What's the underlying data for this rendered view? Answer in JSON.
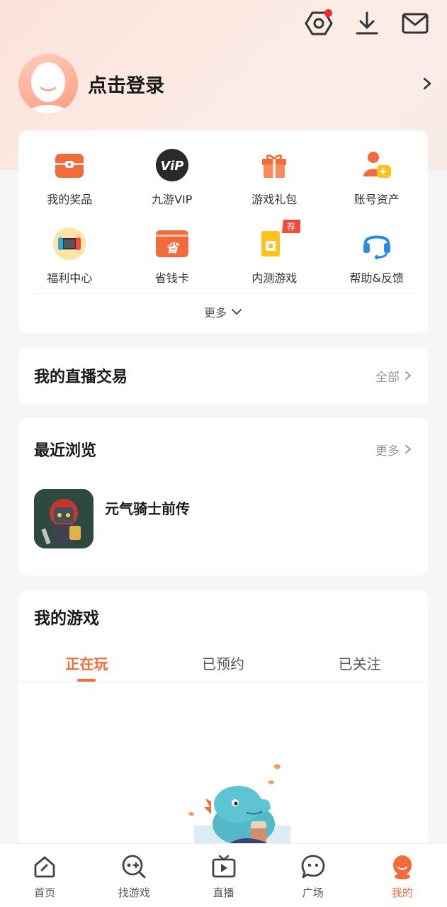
{
  "header": {
    "login_text": "点击登录",
    "icons": [
      "settings-hex-icon",
      "download-icon",
      "mail-icon"
    ],
    "settings_has_notification": true
  },
  "menu": {
    "items": [
      {
        "label": "我的奖品",
        "icon": "prize-box-icon"
      },
      {
        "label": "九游VIP",
        "icon": "vip-badge-icon"
      },
      {
        "label": "游戏礼包",
        "icon": "gift-icon"
      },
      {
        "label": "账号资产",
        "icon": "account-assets-icon"
      },
      {
        "label": "福利中心",
        "icon": "switch-console-icon"
      },
      {
        "label": "省钱卡",
        "icon": "save-card-icon"
      },
      {
        "label": "内测游戏",
        "icon": "beta-game-icon",
        "badge": "荐"
      },
      {
        "label": "帮助&反馈",
        "icon": "headset-icon"
      }
    ],
    "more_label": "更多"
  },
  "live_trade": {
    "title": "我的直播交易",
    "link": "全部"
  },
  "recent": {
    "title": "最近浏览",
    "link": "更多",
    "games": [
      {
        "name": "元气骑士前传"
      }
    ]
  },
  "my_games": {
    "title": "我的游戏",
    "tabs": [
      {
        "label": "正在玩",
        "active": true
      },
      {
        "label": "已预约",
        "active": false
      },
      {
        "label": "已关注",
        "active": false
      }
    ]
  },
  "bottom_nav": {
    "items": [
      {
        "label": "首页",
        "icon": "home-icon",
        "active": false
      },
      {
        "label": "找游戏",
        "icon": "find-game-icon",
        "active": false
      },
      {
        "label": "直播",
        "icon": "live-tv-icon",
        "active": false
      },
      {
        "label": "广场",
        "icon": "chat-bubble-icon",
        "active": false
      },
      {
        "label": "我的",
        "icon": "profile-mascot-icon",
        "active": true
      }
    ]
  },
  "colors": {
    "accent": "#f26b3a",
    "notification": "#f42a2a"
  }
}
